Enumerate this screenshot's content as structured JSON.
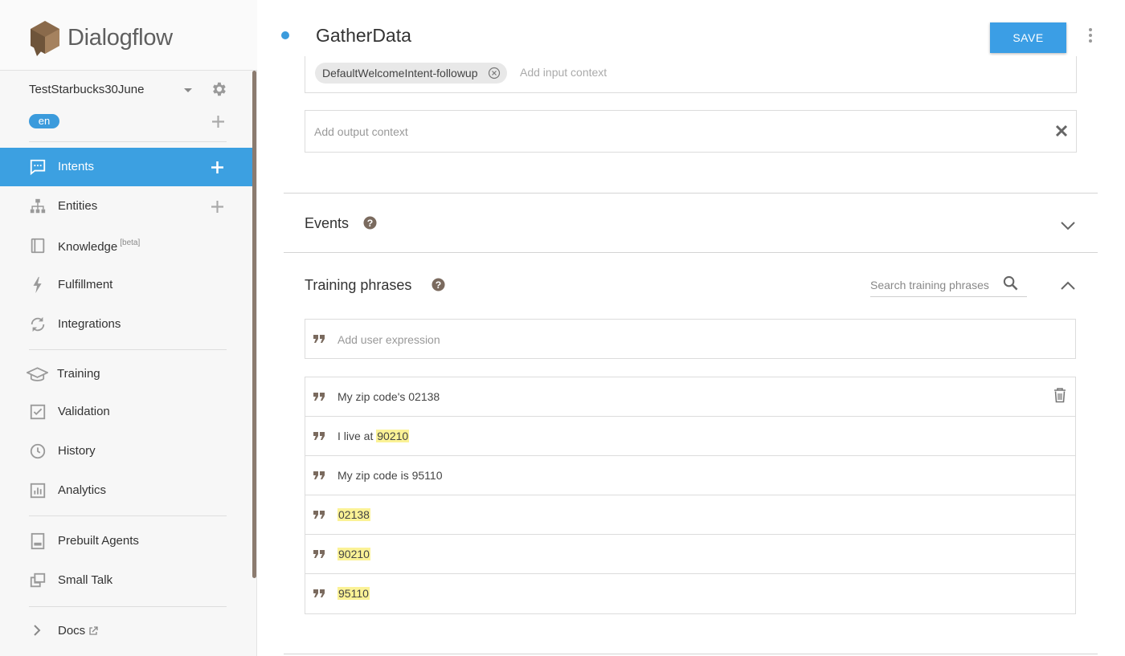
{
  "brand": {
    "name": "Dialogflow",
    "accent": "#3ca0e1"
  },
  "agent": {
    "name": "TestStarbucks30June",
    "language": "en"
  },
  "nav": {
    "items": [
      {
        "label": "Intents",
        "icon": "chat-bubble-icon",
        "active": true,
        "add": true
      },
      {
        "label": "Entities",
        "icon": "hierarchy-icon",
        "add": true
      },
      {
        "label": "Knowledge",
        "badge": "[beta]",
        "icon": "book-icon"
      },
      {
        "label": "Fulfillment",
        "icon": "bolt-icon"
      },
      {
        "label": "Integrations",
        "icon": "sync-icon"
      },
      {
        "label": "Training",
        "icon": "graduation-cap-icon"
      },
      {
        "label": "Validation",
        "icon": "checkbox-icon"
      },
      {
        "label": "History",
        "icon": "clock-icon"
      },
      {
        "label": "Analytics",
        "icon": "bar-chart-icon"
      },
      {
        "label": "Prebuilt Agents",
        "icon": "agent-book-icon"
      },
      {
        "label": "Small Talk",
        "icon": "speech-bubbles-icon"
      },
      {
        "label": "Docs",
        "icon": "chevron-right-icon",
        "external": true
      }
    ]
  },
  "intent": {
    "title": "GatherData",
    "save_label": "SAVE"
  },
  "contexts": {
    "input_chip": "DefaultWelcomeIntent-followup",
    "input_placeholder": "Add input context",
    "output_placeholder": "Add output context"
  },
  "events": {
    "title": "Events"
  },
  "training": {
    "title": "Training phrases",
    "search_placeholder": "Search training phrases",
    "add_placeholder": "Add user expression",
    "phrases": [
      {
        "text": "My zip code's 02138",
        "highlight": ""
      },
      {
        "prefix": "I live at ",
        "highlight": "90210"
      },
      {
        "text": "My zip code is 95110",
        "highlight": ""
      },
      {
        "prefix": "",
        "highlight": "02138"
      },
      {
        "prefix": "",
        "highlight": "90210"
      },
      {
        "prefix": "",
        "highlight": "95110"
      }
    ]
  }
}
